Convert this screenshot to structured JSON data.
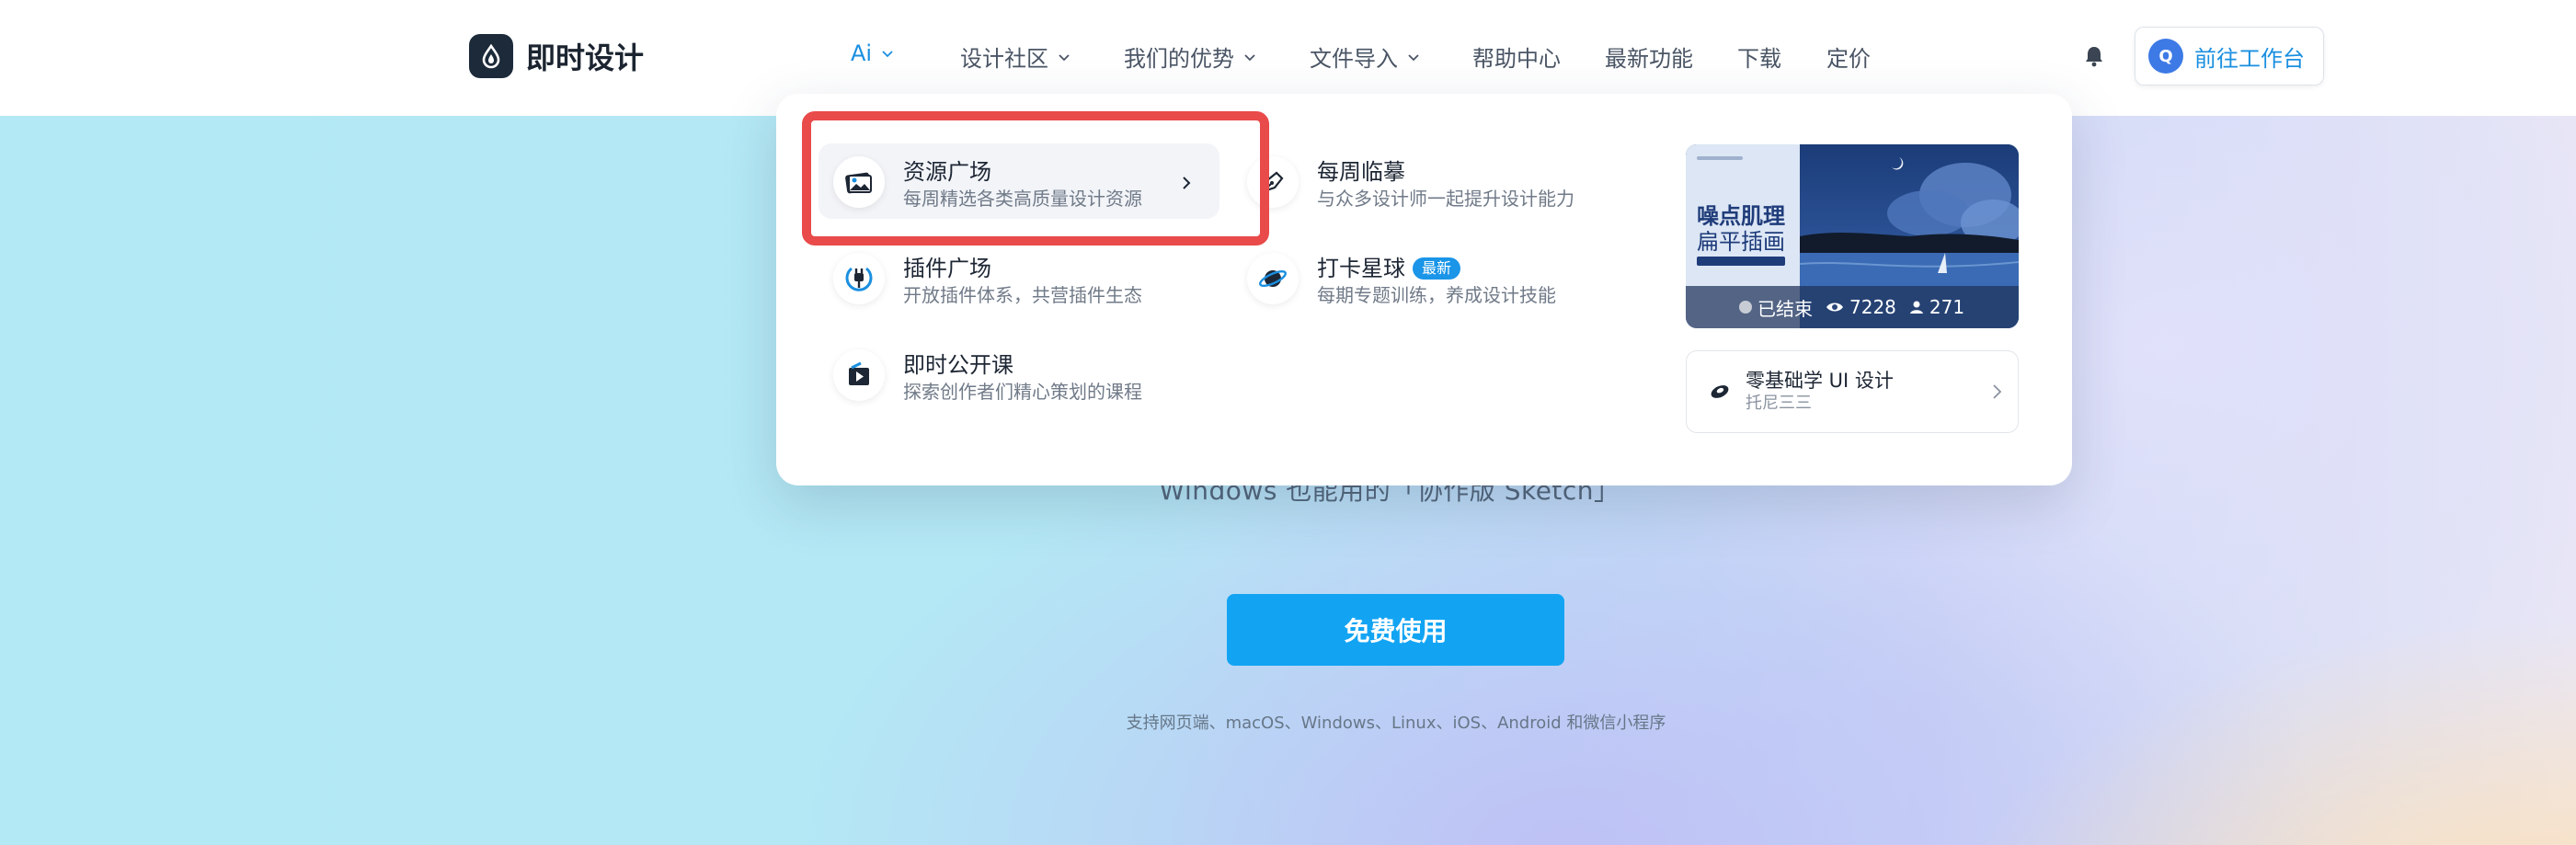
{
  "header": {
    "logo_text": "即时设计",
    "nav": [
      {
        "label": "Ai",
        "has_chevron": true,
        "active": true
      },
      {
        "label": "设计社区",
        "has_chevron": true
      },
      {
        "label": "我们的优势",
        "has_chevron": true
      },
      {
        "label": "文件导入",
        "has_chevron": true
      },
      {
        "label": "帮助中心"
      },
      {
        "label": "最新功能"
      },
      {
        "label": "下载"
      },
      {
        "label": "定价"
      }
    ],
    "avatar_letter": "Q",
    "workspace_label": "前往工作台"
  },
  "dropdown": {
    "items": [
      {
        "title": "资源广场",
        "desc": "每周精选各类高质量设计资源",
        "icon": "image-gallery-icon"
      },
      {
        "title": "每周临摹",
        "desc": "与众多设计师一起提升设计能力",
        "icon": "pen-nib-icon"
      },
      {
        "title": "插件广场",
        "desc": "开放插件体系，共营插件生态",
        "icon": "plug-icon"
      },
      {
        "title": "打卡星球",
        "desc": "每期专题训练，养成设计技能",
        "icon": "planet-icon",
        "badge": "最新"
      },
      {
        "title": "即时公开课",
        "desc": "探索创作者们精心策划的课程",
        "icon": "video-play-icon"
      }
    ],
    "promo": {
      "title_line1": "噪点肌理",
      "title_line2": "扁平插画",
      "status": "已结束",
      "views": "7228",
      "participants": "271"
    },
    "course": {
      "title": "零基础学 UI 设计",
      "author": "托尼三三"
    }
  },
  "hero": {
    "subtitle": "Windows 也能用的「协作版 Sketch」",
    "cta_label": "免费使用",
    "platforms": "支持网页端、macOS、Windows、Linux、iOS、Android 和微信小程序"
  },
  "colors": {
    "accent": "#1a8fe0",
    "cta": "#12a4f3",
    "highlight": "#e94a4a"
  }
}
